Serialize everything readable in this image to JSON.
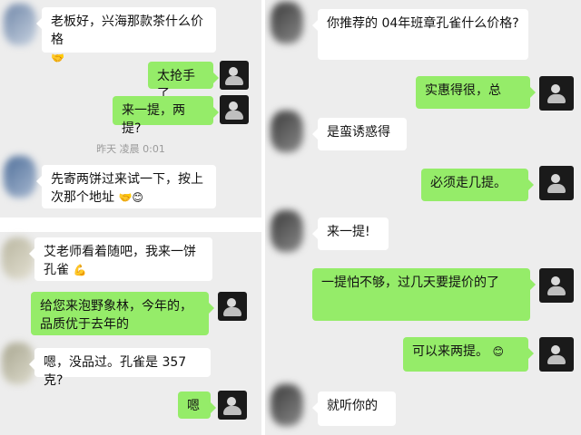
{
  "left_panel": {
    "messages": [
      {
        "id": "m1",
        "side": "in",
        "text": "老板好，兴海那款茶什么价格",
        "emoji": "🤝"
      },
      {
        "id": "m2",
        "side": "out",
        "text": "太抢手了"
      },
      {
        "id": "m3",
        "side": "out",
        "text": "来一提，两提?"
      },
      {
        "id": "ts",
        "type": "timestamp",
        "text": "昨天 凌晨 0:01"
      },
      {
        "id": "m4",
        "side": "in",
        "text": "先寄两饼过来试一下，按上次那个地址",
        "emoji": "🤝😊"
      },
      {
        "id": "m5",
        "side": "in",
        "text": "艾老师看着随吧，我来一饼孔雀",
        "emoji": "💪"
      },
      {
        "id": "m6",
        "side": "out",
        "text": "给您来泡野象林，今年的，品质优于去年的"
      },
      {
        "id": "m7",
        "side": "in",
        "text": "嗯，没品过。孔雀是 357克?"
      },
      {
        "id": "m8",
        "side": "out",
        "text": "嗯"
      }
    ]
  },
  "right_panel": {
    "messages": [
      {
        "id": "r1",
        "side": "in",
        "text": "你推荐的 04年班章孔雀什么价格?"
      },
      {
        "id": "r2",
        "side": "out",
        "text": "实惠得很，总"
      },
      {
        "id": "r3",
        "side": "in",
        "text": "是蛮诱惑得"
      },
      {
        "id": "r4",
        "side": "out",
        "text": "必须走几提。"
      },
      {
        "id": "r5",
        "side": "in",
        "text": "来一提!"
      },
      {
        "id": "r6",
        "side": "out",
        "text": "一提怕不够，过几天要提价的了"
      },
      {
        "id": "r7",
        "side": "out",
        "text": "可以来两提。",
        "emoji": "😊"
      },
      {
        "id": "r8",
        "side": "in",
        "text": "就听你的"
      }
    ]
  },
  "icons": {
    "incoming_avatar": "blurred-avatar-icon",
    "outgoing_avatar": "portrait-avatar-icon"
  },
  "colors": {
    "chat_background": "#ededed",
    "incoming_bubble": "#ffffff",
    "outgoing_bubble": "#95ec69",
    "avatar_dark": "#1a1a1a"
  }
}
